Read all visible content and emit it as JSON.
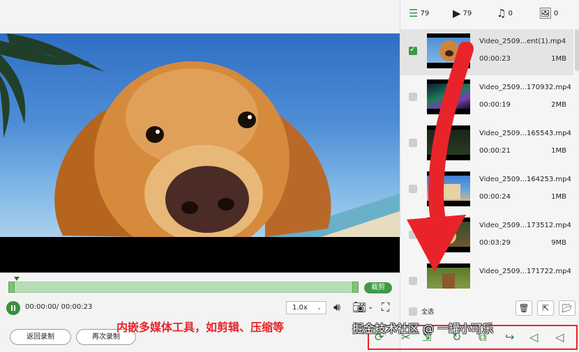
{
  "player": {
    "trim_label": "裁剪",
    "time_display": "00:00:00/ 00:00:23",
    "speed": "1.0x",
    "back_button": "返回录制",
    "rerecord_button": "再次录制"
  },
  "filters": {
    "all_count": "79",
    "video_count": "79",
    "audio_count": "0",
    "image_count": "0"
  },
  "files": [
    {
      "name": "Video_2509...ent(1).mp4",
      "duration": "00:00:23",
      "size": "1MB",
      "selected": true,
      "thumb": "dog"
    },
    {
      "name": "Video_2509...170932.mp4",
      "duration": "00:00:19",
      "size": "2MB",
      "selected": false,
      "thumb": "aurora"
    },
    {
      "name": "Video_2509...165543.mp4",
      "duration": "00:00:21",
      "size": "1MB",
      "selected": false,
      "thumb": "dark"
    },
    {
      "name": "Video_2509...164253.mp4",
      "duration": "00:00:24",
      "size": "1MB",
      "selected": false,
      "thumb": "temple"
    },
    {
      "name": "Video_2509...173512.mp4",
      "duration": "00:03:29",
      "size": "9MB",
      "selected": false,
      "thumb": "animal"
    },
    {
      "name": "Video_2509...171722.mp4",
      "duration": "",
      "size": "",
      "selected": false,
      "thumb": "deer"
    }
  ],
  "panel": {
    "select_all": "全选"
  },
  "annotations": {
    "caption": "内嵌多媒体工具，如剪辑、压缩等",
    "watermark": "掘金技术社区 @ 一罐小可乐"
  },
  "colors": {
    "accent": "#3a8f3f",
    "annotation": "#e8242a"
  }
}
